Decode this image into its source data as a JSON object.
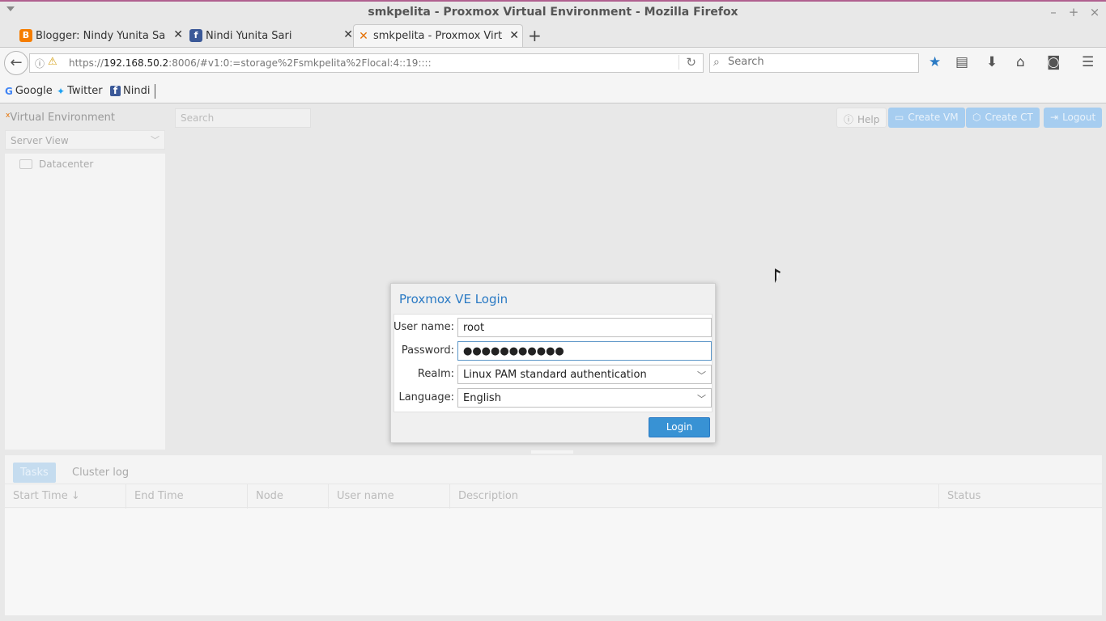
{
  "window": {
    "title": "smkpelita - Proxmox Virtual Environment - Mozilla Firefox",
    "controls": [
      "–",
      "+",
      "×"
    ]
  },
  "tabs": [
    {
      "label": "Blogger: Nindy Yunita Sar...",
      "icon": "blogger-icon",
      "icon_color": "#f57d00",
      "icon_glyph": "B",
      "active": false
    },
    {
      "label": "Nindi Yunita Sari",
      "icon": "facebook-icon",
      "icon_color": "#3b5998",
      "icon_glyph": "f",
      "active": false
    },
    {
      "label": "smkpelita - Proxmox Virtu...",
      "icon": "proxmox-icon",
      "icon_color": "#e57000",
      "icon_glyph": "✕",
      "active": true
    }
  ],
  "navbar": {
    "url_prefix": "https://",
    "url_host": "192.168.50.2",
    "url_rest": ":8006/#v1:0:=storage%2Fsmkpelita%2Flocal:4::19::::",
    "search_placeholder": "Search"
  },
  "bookmarks": [
    {
      "label": "Google",
      "icon": "google-icon",
      "color": "#4285f4",
      "glyph": "G"
    },
    {
      "label": "Twitter",
      "icon": "twitter-icon",
      "color": "#1da1f2",
      "glyph": "🐦"
    },
    {
      "label": "Nindi",
      "icon": "facebook-icon",
      "color": "#3b5998",
      "glyph": "f"
    }
  ],
  "pve": {
    "brand": "Virtual Environment",
    "search_placeholder": "Search",
    "buttons": {
      "help": "Help",
      "create_vm": "Create VM",
      "create_ct": "Create CT",
      "logout": "Logout"
    },
    "server_view": "Server View",
    "tree_root": "Datacenter",
    "bottom_tabs": {
      "tasks": "Tasks",
      "cluster_log": "Cluster log"
    },
    "columns": [
      "Start Time ↓",
      "End Time",
      "Node",
      "User name",
      "Description",
      "Status"
    ]
  },
  "login": {
    "title": "Proxmox VE Login",
    "username_label": "User name:",
    "username_value": "root",
    "password_label": "Password:",
    "password_value": "●●●●●●●●●●●",
    "realm_label": "Realm:",
    "realm_value": "Linux PAM standard authentication",
    "language_label": "Language:",
    "language_value": "English",
    "login_button": "Login"
  },
  "colors": {
    "accent": "#3892d4",
    "title_blue": "#2a7ac4",
    "proxmox_orange": "#e57000"
  }
}
